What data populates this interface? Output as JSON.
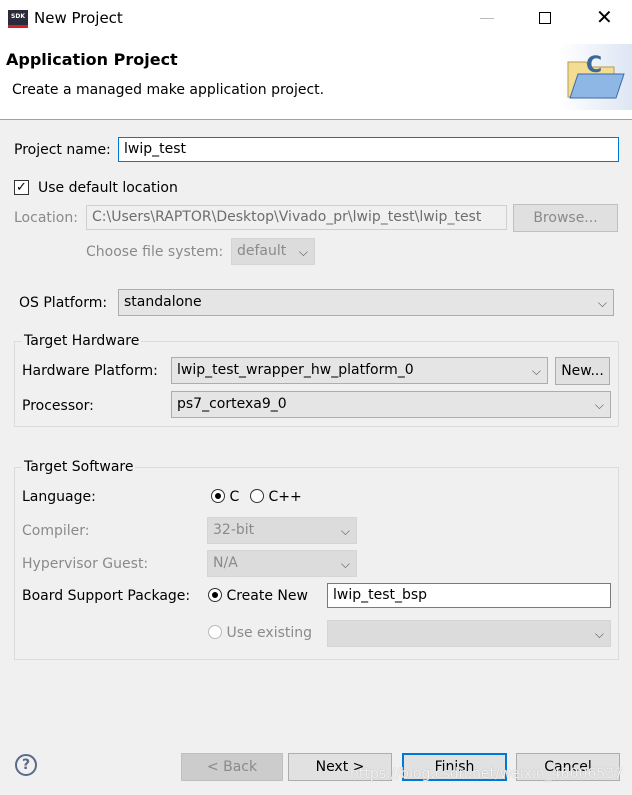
{
  "window": {
    "title": "New Project",
    "app_icon": "SDK"
  },
  "header": {
    "title": "Application Project",
    "subtitle": "Create a managed make application project."
  },
  "form": {
    "project_name_label": "Project name:",
    "project_name": "lwip_test",
    "use_default_label": "Use default location",
    "use_default_checked": true,
    "location_label": "Location:",
    "location": "C:\\Users\\RAPTOR\\Desktop\\Vivado_pr\\lwip_test\\lwip_test",
    "browse": "Browse...",
    "fs_label": "Choose file system:",
    "fs": "default",
    "os_label": "OS Platform:",
    "os": "standalone"
  },
  "hardware": {
    "title": "Target Hardware",
    "platform_label": "Hardware Platform:",
    "platform": "lwip_test_wrapper_hw_platform_0",
    "new": "New...",
    "processor_label": "Processor:",
    "processor": "ps7_cortexa9_0"
  },
  "software": {
    "title": "Target Software",
    "language_label": "Language:",
    "lang_c": "C",
    "lang_cpp": "C++",
    "selected_language": "C",
    "compiler_label": "Compiler:",
    "compiler": "32-bit",
    "hyp_label": "Hypervisor Guest:",
    "hyp": "N/A",
    "bsp_label": "Board Support Package:",
    "create_new": "Create New",
    "bsp_name": "lwip_test_bsp",
    "use_existing": "Use existing",
    "bsp_choice": "Create New"
  },
  "buttons": {
    "back": "< Back",
    "next": "Next >",
    "finish": "Finish",
    "cancel": "Cancel"
  },
  "watermark": "https://blog.csdn.net/weixin_46006537"
}
